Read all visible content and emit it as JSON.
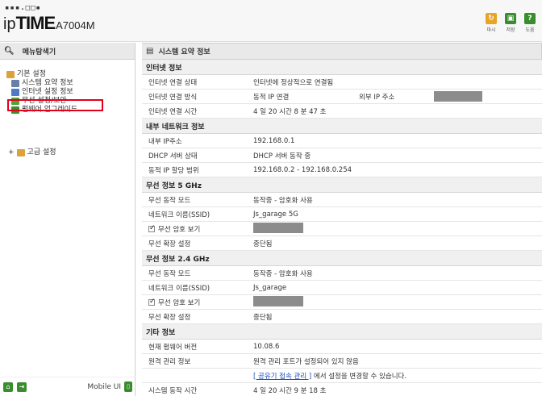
{
  "header": {
    "logo_dots": "▪▪▪.□□▪",
    "logo_ip": "ip",
    "logo_time": "TIME",
    "logo_model": "A7004M",
    "buttons": [
      {
        "label": "마시",
        "color": "#e8a424",
        "glyph": "↻",
        "icon": "refresh-icon"
      },
      {
        "label": "저장",
        "color": "#3a8d2e",
        "glyph": "▣",
        "icon": "save-icon"
      },
      {
        "label": "도움",
        "color": "#3a8d2e",
        "glyph": "?",
        "icon": "help-icon"
      }
    ]
  },
  "sidebar": {
    "title": "메뉴탐색기",
    "basic": {
      "label": "기본 설정",
      "items": [
        "시스템 요약 정보",
        "인터넷 설정 정보",
        "무선 설정/보안",
        "펌웨어 업그레이드"
      ]
    },
    "advanced": "고급 설정",
    "mobile_label": "Mobile UI"
  },
  "main": {
    "title": "시스템 요약 정보",
    "internet": {
      "header": "인터넷 정보",
      "status_label": "인터넷 연결 상태",
      "status_value": "인터넷에 정상적으로 연결됨",
      "method_label": "인터넷 연결 방식",
      "method_value": "동적 IP 연결",
      "external_ip_label": "외부 IP 주소",
      "time_label": "인터넷 연결 시간",
      "time_value": "4 일 20 시간 8 분 47 초"
    },
    "lan": {
      "header": "내부 네트워크 정보",
      "ip_label": "내부 IP주소",
      "ip_value": "192.168.0.1",
      "dhcp_label": "DHCP 서버 상태",
      "dhcp_value": "DHCP 서버 동작 중",
      "range_label": "동적 IP 할당 범위",
      "range_value": "192.168.0.2 -  192.168.0.254"
    },
    "wifi5": {
      "header": "무선 정보 5 GHz",
      "mode_label": "무선 동작 모드",
      "mode_value": "동작중 - 암호화 사용",
      "ssid_label": "네트워크 이름(SSID)",
      "ssid_value": "Js_garage 5G",
      "pw_label": "무선 암호 보기",
      "ext_label": "무선 확장 설정",
      "ext_value": "중단됨"
    },
    "wifi24": {
      "header": "무선 정보 2.4 GHz",
      "mode_label": "무선 동작 모드",
      "mode_value": "동작중 - 암호화 사용",
      "ssid_label": "네트워크 이름(SSID)",
      "ssid_value": "Js_garage",
      "pw_label": "무선 암호 보기",
      "ext_label": "무선 확장 설정",
      "ext_value": "중단됨"
    },
    "etc": {
      "header": "기타 정보",
      "fw_label": "현재 펌웨어 버전",
      "fw_value": "10.08.6",
      "remote_label": "원격 관리 정보",
      "remote_value": "원격 관리 포트가 설정되어 있지 않음",
      "remote_link": "[ 공유기 접속 관리 ]",
      "remote_link_suffix": " 에서 설정을 변경할 수 있습니다.",
      "uptime_label": "시스템 동작 시간",
      "uptime_value": "4 일 20 시간 9 분 18 초"
    }
  }
}
